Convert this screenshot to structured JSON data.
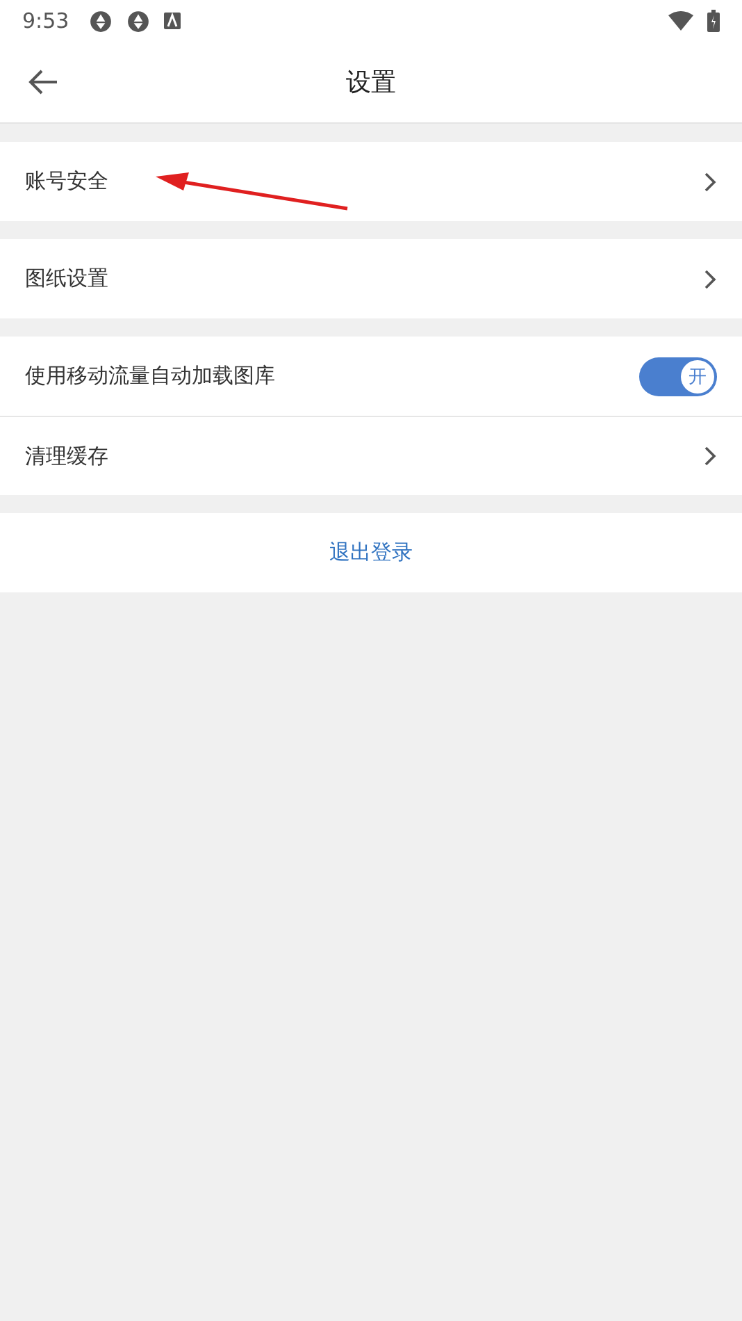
{
  "status_bar": {
    "time": "9:53"
  },
  "header": {
    "title": "设置"
  },
  "groups": [
    {
      "items": [
        {
          "kind": "link",
          "label": "账号安全",
          "annotated": true
        }
      ]
    },
    {
      "items": [
        {
          "kind": "link",
          "label": "图纸设置",
          "annotated": false
        }
      ]
    },
    {
      "items": [
        {
          "kind": "toggle",
          "label": "使用移动流量自动加载图库",
          "on": true,
          "toggle_text": "开",
          "annotated": false
        },
        {
          "kind": "link",
          "label": "清理缓存",
          "annotated": false
        }
      ]
    }
  ],
  "logout": {
    "label": "退出登录"
  }
}
